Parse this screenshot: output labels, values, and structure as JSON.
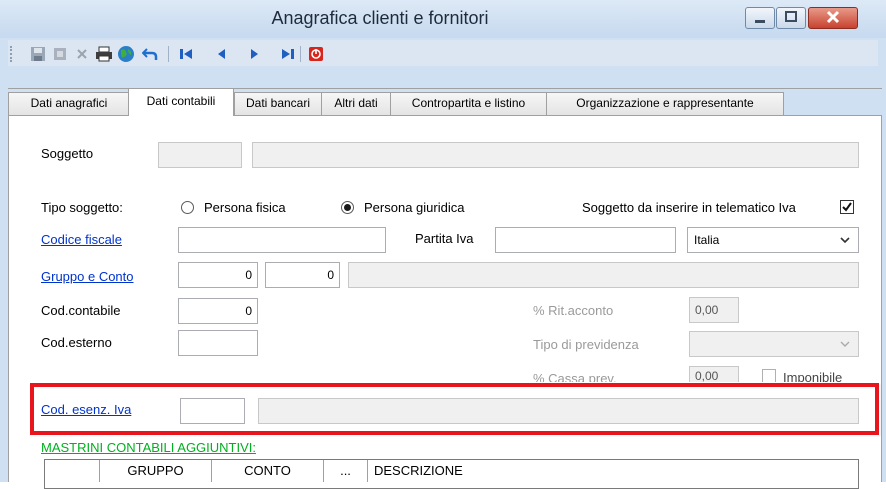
{
  "window": {
    "title": "Anagrafica clienti e fornitori"
  },
  "toolbar": {
    "buttons": [
      "save-icon",
      "delete-icon",
      "cancel-icon",
      "print-icon",
      "globe-icon",
      "undo-icon",
      "first-icon",
      "previous-icon",
      "next-icon",
      "last-icon",
      "exit-icon"
    ]
  },
  "tabs": [
    "Dati anagrafici",
    "Dati contabili",
    "Dati bancari",
    "Altri dati",
    "Contropartita e listino",
    "Organizzazione e rappresentante"
  ],
  "active_tab": "Dati contabili",
  "form": {
    "soggetto_label": "Soggetto",
    "soggetto_code": "",
    "soggetto_name": "",
    "tipo_soggetto_label": "Tipo soggetto:",
    "radio_fisica": "Persona fisica",
    "radio_giuridica": "Persona giuridica",
    "telematico_label": "Soggetto da inserire in telematico Iva",
    "telematico_checked": true,
    "codice_fiscale_label": "Codice fiscale",
    "codice_fiscale_value": "",
    "partita_iva_label": "Partita Iva",
    "partita_iva_value": "",
    "country_value": "Italia",
    "gruppo_conto_label": "Gruppo e Conto",
    "gruppo_value": "0",
    "conto_value": "0",
    "gruppo_descr": "",
    "cod_contabile_label": "Cod.contabile",
    "cod_contabile_value": "0",
    "rit_acconto_label": "% Rit.acconto",
    "rit_acconto_value": "0,00",
    "cod_esterno_label": "Cod.esterno",
    "cod_esterno_value": "",
    "tipo_previdenza_label": "Tipo di previdenza",
    "tipo_previdenza_value": "",
    "cassa_prev_label": "% Cassa prev.",
    "cassa_prev_value": "0,00",
    "imponibile_label": "Imponibile",
    "cod_esenz_label": "Cod. esenz. Iva",
    "cod_esenz_value": "",
    "cod_esenz_descr": ""
  },
  "mastrini": {
    "title": "MASTRINI CONTABILI AGGIUNTIVI:",
    "columns": [
      "",
      "GRUPPO",
      "CONTO",
      "...",
      "DESCRIZIONE"
    ]
  },
  "colors": {
    "highlight": "#e8151c",
    "link": "#0033cc",
    "section": "#00b020"
  }
}
